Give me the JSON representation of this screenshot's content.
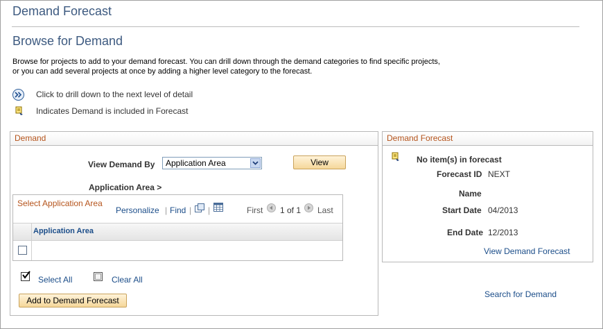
{
  "page": {
    "title": "Demand Forecast",
    "subtitle": "Browse for Demand",
    "intro_line1": "Browse for projects to add to your demand forecast. You can drill down through the demand categories to find specific projects,",
    "intro_line2": "or you can add several projects at once by adding a higher level category to the forecast."
  },
  "legend": {
    "drill_text": "Click to drill down to the next level of detail",
    "included_text": "Indicates Demand is included in Forecast"
  },
  "demand": {
    "header": "Demand",
    "view_by_label": "View Demand By",
    "view_by_value": "Application Area",
    "view_button": "View",
    "breadcrumb": "Application Area >",
    "grid": {
      "title": "Select Application Area",
      "personalize": "Personalize",
      "find": "Find",
      "first": "First",
      "range": "1 of 1",
      "last": "Last",
      "column": "Application Area"
    },
    "select_all": "Select All",
    "clear_all": "Clear All",
    "add_button": "Add to Demand Forecast"
  },
  "forecast": {
    "header": "Demand Forecast",
    "status": "No item(s) in forecast",
    "id_label": "Forecast ID",
    "id_value": "NEXT",
    "name_label": "Name",
    "start_label": "Start Date",
    "start_value": "04/2013",
    "end_label": "End Date",
    "end_value": "12/2013",
    "view_link": "View Demand Forecast"
  },
  "search_link": "Search for Demand",
  "colors": {
    "title": "#3d5a80",
    "group_header": "#b5541c",
    "link": "#1b4d89",
    "button": "#f5d79a"
  }
}
